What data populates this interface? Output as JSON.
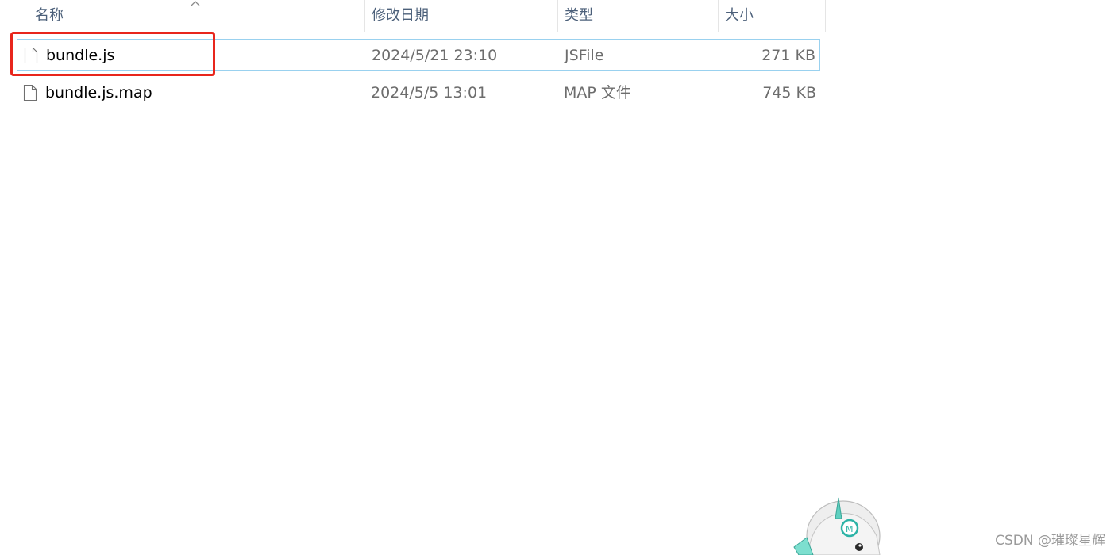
{
  "columns": {
    "name": "名称",
    "modified": "修改日期",
    "type": "类型",
    "size": "大小"
  },
  "files": [
    {
      "name": "bundle.js",
      "modified": "2024/5/21 23:10",
      "type": "JSFile",
      "size": "271 KB",
      "selected": true,
      "icon": "document-icon"
    },
    {
      "name": "bundle.js.map",
      "modified": "2024/5/5 13:01",
      "type": "MAP 文件",
      "size": "745 KB",
      "selected": false,
      "icon": "document-icon"
    }
  ],
  "annotation": {
    "color": "#e8261c",
    "target": "bundle.js"
  },
  "watermark": "CSDN @璀璨星辉",
  "colors": {
    "header_text": "#4c607a",
    "selection_border": "#99d1ef",
    "meta_text": "#6d6d6d"
  }
}
